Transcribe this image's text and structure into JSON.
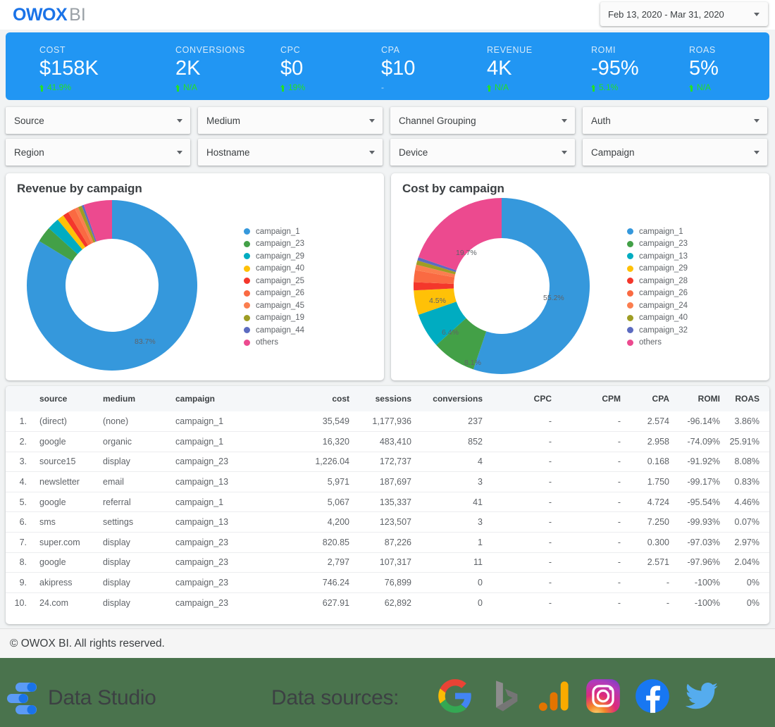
{
  "header": {
    "logo_primary": "OWOX",
    "logo_secondary": "BI",
    "date_range": "Feb 13, 2020 - Mar 31, 2020"
  },
  "kpis": [
    {
      "label": "COST",
      "value": "$158K",
      "delta": "41.9%",
      "has_arrow": true
    },
    {
      "label": "CONVERSIONS",
      "value": "2K",
      "delta": "N/A",
      "has_arrow": true
    },
    {
      "label": "CPC",
      "value": "$0",
      "delta": "19%",
      "has_arrow": true
    },
    {
      "label": "CPA",
      "value": "$10",
      "delta": "-",
      "has_arrow": false
    },
    {
      "label": "REVENUE",
      "value": "4K",
      "delta": "N/A",
      "has_arrow": true
    },
    {
      "label": "ROMI",
      "value": "-95%",
      "delta": "5.1%",
      "has_arrow": true
    },
    {
      "label": "ROAS",
      "value": "5%",
      "delta": "N/A",
      "has_arrow": true
    }
  ],
  "filters": [
    {
      "label": "Source"
    },
    {
      "label": "Medium"
    },
    {
      "label": "Channel Grouping"
    },
    {
      "label": "Auth"
    },
    {
      "label": "Region"
    },
    {
      "label": "Hostname"
    },
    {
      "label": "Device"
    },
    {
      "label": "Campaign"
    }
  ],
  "chart_data": [
    {
      "type": "pie",
      "title": "Revenue by campaign",
      "categories": [
        "campaign_1",
        "campaign_23",
        "campaign_29",
        "campaign_40",
        "campaign_25",
        "campaign_26",
        "campaign_45",
        "campaign_19",
        "campaign_44",
        "others"
      ],
      "values": [
        83.7,
        3.0,
        2.3,
        1.3,
        1.1,
        1.4,
        0.7,
        0.7,
        0.4,
        5.4
      ],
      "colors": [
        "#3598dc",
        "#43a047",
        "#00acc1",
        "#ffc107",
        "#f4372b",
        "#fa6a42",
        "#fb7e4f",
        "#9e9d24",
        "#5c6bc0",
        "#ec4a8f"
      ],
      "labels_shown": [
        {
          "text": "83.7%",
          "slice": "campaign_1"
        }
      ],
      "legend_position": "right",
      "donut": true
    },
    {
      "type": "pie",
      "title": "Cost by campaign",
      "categories": [
        "campaign_1",
        "campaign_23",
        "campaign_13",
        "campaign_29",
        "campaign_28",
        "campaign_26",
        "campaign_24",
        "campaign_40",
        "campaign_32",
        "others"
      ],
      "values": [
        55.2,
        8.1,
        6.4,
        4.5,
        1.5,
        2.2,
        1.0,
        0.8,
        0.6,
        19.7
      ],
      "colors": [
        "#3598dc",
        "#43a047",
        "#00acc1",
        "#ffc107",
        "#f4372b",
        "#fa6a42",
        "#fb7e4f",
        "#9e9d24",
        "#5c6bc0",
        "#ec4a8f"
      ],
      "labels_shown": [
        {
          "text": "55.2%",
          "slice": "campaign_1"
        },
        {
          "text": "19.7%",
          "slice": "others"
        },
        {
          "text": "8.1%",
          "slice": "campaign_23"
        },
        {
          "text": "6.4%",
          "slice": "campaign_13"
        },
        {
          "text": "4.5%",
          "slice": "campaign_29"
        }
      ],
      "legend_position": "right",
      "donut": true
    }
  ],
  "table": {
    "columns": [
      "",
      "source",
      "medium",
      "campaign",
      "cost",
      "sessions",
      "conversions",
      "CPC",
      "CPM",
      "CPA",
      "ROMI",
      "ROAS"
    ],
    "rows": [
      {
        "idx": "1.",
        "source": "(direct)",
        "medium": "(none)",
        "campaign": "campaign_1",
        "cost": "35,549",
        "sessions": "1,177,936",
        "conversions": "237",
        "cpc": "-",
        "cpm": "-",
        "cpa": "2.574",
        "romi": "-96.14%",
        "roas": "3.86%"
      },
      {
        "idx": "2.",
        "source": "google",
        "medium": "organic",
        "campaign": "campaign_1",
        "cost": "16,320",
        "sessions": "483,410",
        "conversions": "852",
        "cpc": "-",
        "cpm": "-",
        "cpa": "2.958",
        "romi": "-74.09%",
        "roas": "25.91%"
      },
      {
        "idx": "3.",
        "source": "source15",
        "medium": "display",
        "campaign": "campaign_23",
        "cost": "1,226.04",
        "sessions": "172,737",
        "conversions": "4",
        "cpc": "-",
        "cpm": "-",
        "cpa": "0.168",
        "romi": "-91.92%",
        "roas": "8.08%"
      },
      {
        "idx": "4.",
        "source": "newsletter",
        "medium": "email",
        "campaign": "campaign_13",
        "cost": "5,971",
        "sessions": "187,697",
        "conversions": "3",
        "cpc": "-",
        "cpm": "-",
        "cpa": "1.750",
        "romi": "-99.17%",
        "roas": "0.83%"
      },
      {
        "idx": "5.",
        "source": "google",
        "medium": "referral",
        "campaign": "campaign_1",
        "cost": "5,067",
        "sessions": "135,337",
        "conversions": "41",
        "cpc": "-",
        "cpm": "-",
        "cpa": "4.724",
        "romi": "-95.54%",
        "roas": "4.46%"
      },
      {
        "idx": "6.",
        "source": "sms",
        "medium": "settings",
        "campaign": "campaign_13",
        "cost": "4,200",
        "sessions": "123,507",
        "conversions": "3",
        "cpc": "-",
        "cpm": "-",
        "cpa": "7.250",
        "romi": "-99.93%",
        "roas": "0.07%"
      },
      {
        "idx": "7.",
        "source": "super.com",
        "medium": "display",
        "campaign": "campaign_23",
        "cost": "820.85",
        "sessions": "87,226",
        "conversions": "1",
        "cpc": "-",
        "cpm": "-",
        "cpa": "0.300",
        "romi": "-97.03%",
        "roas": "2.97%"
      },
      {
        "idx": "8.",
        "source": "google",
        "medium": "display",
        "campaign": "campaign_23",
        "cost": "2,797",
        "sessions": "107,317",
        "conversions": "11",
        "cpc": "-",
        "cpm": "-",
        "cpa": "2.571",
        "romi": "-97.96%",
        "roas": "2.04%"
      },
      {
        "idx": "9.",
        "source": "akipress",
        "medium": "display",
        "campaign": "campaign_23",
        "cost": "746.24",
        "sessions": "76,899",
        "conversions": "0",
        "cpc": "-",
        "cpm": "-",
        "cpa": "-",
        "romi": "-100%",
        "roas": "0%"
      },
      {
        "idx": "10.",
        "source": "24.com",
        "medium": "display",
        "campaign": "campaign_23",
        "cost": "627.91",
        "sessions": "62,892",
        "conversions": "0",
        "cpc": "-",
        "cpm": "-",
        "cpa": "-",
        "romi": "-100%",
        "roas": "0%"
      }
    ]
  },
  "copyright": "© OWOX BI. All rights reserved.",
  "footer": {
    "data_studio_label": "Data Studio",
    "data_sources_label": "Data sources:",
    "source_icons": [
      "google-icon",
      "bing-icon",
      "google-analytics-icon",
      "instagram-icon",
      "facebook-icon",
      "twitter-icon"
    ],
    "background_color": "#4a734d"
  }
}
